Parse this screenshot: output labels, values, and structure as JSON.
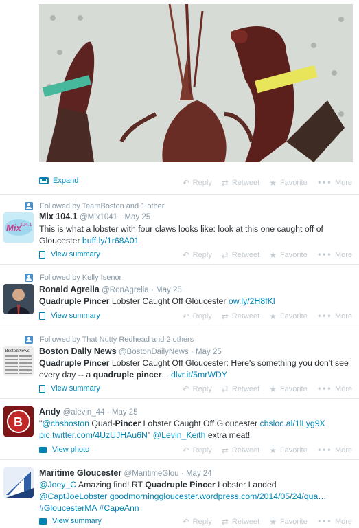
{
  "colors": {
    "link": "#0084b4",
    "muted": "#8899a6",
    "action": "#c5ccd1"
  },
  "media_tweet": {
    "expand_label": "Expand",
    "actions": {
      "reply": "Reply",
      "retweet": "Retweet",
      "favorite": "Favorite",
      "more": "More"
    }
  },
  "tweets": [
    {
      "context": "Followed by TeamBoston and 1 other",
      "name": "Mix 104.1",
      "handle": "@Mix1041",
      "date": "May 25",
      "body_parts": [
        "This is what a lobster with four claws looks like: look at this one caught off of Gloucester ",
        "buff.ly/1r68A01"
      ],
      "footer": "View summary",
      "footer_icon": "document-icon",
      "actions": {
        "reply": "Reply",
        "retweet": "Retweet",
        "favorite": "Favorite",
        "more": "More"
      }
    },
    {
      "context": "Followed by Kelly Isenor",
      "name": "Ronald Agrella",
      "handle": "@RonAgrella",
      "date": "May 25",
      "body_parts": [
        "Quadruple Pincer",
        " Lobster Caught Off Gloucester ",
        "ow.ly/2H8fKl"
      ],
      "footer": "View summary",
      "footer_icon": "document-icon",
      "actions": {
        "reply": "Reply",
        "retweet": "Retweet",
        "favorite": "Favorite",
        "more": "More"
      }
    },
    {
      "context": "Followed by That Nutty Redhead and 2 others",
      "name": "Boston Daily News",
      "handle": "@BostonDailyNews",
      "date": "May 25",
      "body_parts": [
        "Quadruple Pincer",
        " Lobster Caught Off Gloucester: Here's something you don't see every day -- a ",
        "quadruple pincer",
        "... ",
        "dlvr.it/5mrWDY"
      ],
      "footer": "View summary",
      "footer_icon": "document-icon",
      "actions": {
        "reply": "Reply",
        "retweet": "Retweet",
        "favorite": "Favorite",
        "more": "More"
      }
    },
    {
      "context": "",
      "name": "Andy",
      "handle": "@alevin_44",
      "date": "May 25",
      "body_parts": [
        "\"",
        "@cbsboston",
        " Quad-",
        "Pincer",
        " Lobster Caught Off Gloucester ",
        "cbsloc.al/1lLyg9X",
        "pic.twitter.com/4UzUJHAu6N",
        "\" ",
        "@Levin_Keith",
        " extra meat!"
      ],
      "footer": "View photo",
      "footer_icon": "photo-icon",
      "actions": {
        "reply": "Reply",
        "retweet": "Retweet",
        "favorite": "Favorite",
        "more": "More"
      }
    },
    {
      "context": "",
      "name": "Maritime Gloucester",
      "handle": "@MaritimeGlou",
      "date": "May 24",
      "body_parts": [
        "@Joey_C",
        " Amazing find! RT ",
        "Quadruple Pincer",
        " Lobster Landed",
        "@CaptJoeLobster",
        "goodmorninggloucester.wordpress.com/2014/05/24/qua…",
        "#GloucesterMA",
        "#CapeAnn"
      ],
      "footer": "View summary",
      "footer_icon": "photo-icon",
      "actions": {
        "reply": "Reply",
        "retweet": "Retweet",
        "favorite": "Favorite",
        "more": "More"
      }
    }
  ]
}
